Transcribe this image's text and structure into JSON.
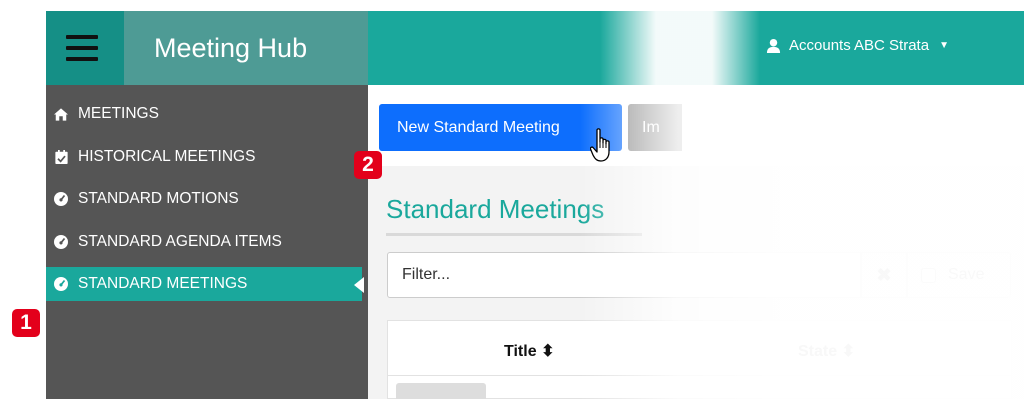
{
  "app": {
    "title": "Meeting Hub",
    "user_name": "Accounts ABC Strata"
  },
  "sidebar": {
    "items": [
      {
        "label": "MEETINGS",
        "icon": "home-icon"
      },
      {
        "label": "HISTORICAL MEETINGS",
        "icon": "calendar-check-icon"
      },
      {
        "label": "STANDARD MOTIONS",
        "icon": "gauge-icon"
      },
      {
        "label": "STANDARD AGENDA ITEMS",
        "icon": "gauge-icon"
      },
      {
        "label": "STANDARD MEETINGS",
        "icon": "gauge-icon",
        "active": true
      }
    ]
  },
  "toolbar": {
    "new_button_label": "New Standard Meeting",
    "import_button_label": "Im"
  },
  "main": {
    "page_title": "Standard Meetings",
    "filter": {
      "placeholder": "Filter...",
      "value": ""
    },
    "clear_symbol": "✖",
    "save_label": "Save",
    "table": {
      "columns": [
        {
          "label": "Title",
          "sort_icon": "sort-icon"
        },
        {
          "label": "State",
          "sort_icon": "sort-icon"
        }
      ]
    }
  },
  "callouts": [
    "1",
    "2"
  ],
  "colors": {
    "accent": "#1aa89c",
    "sidebar": "#555555",
    "primary_button": "#0d6efd",
    "callout": "#e3001b"
  }
}
